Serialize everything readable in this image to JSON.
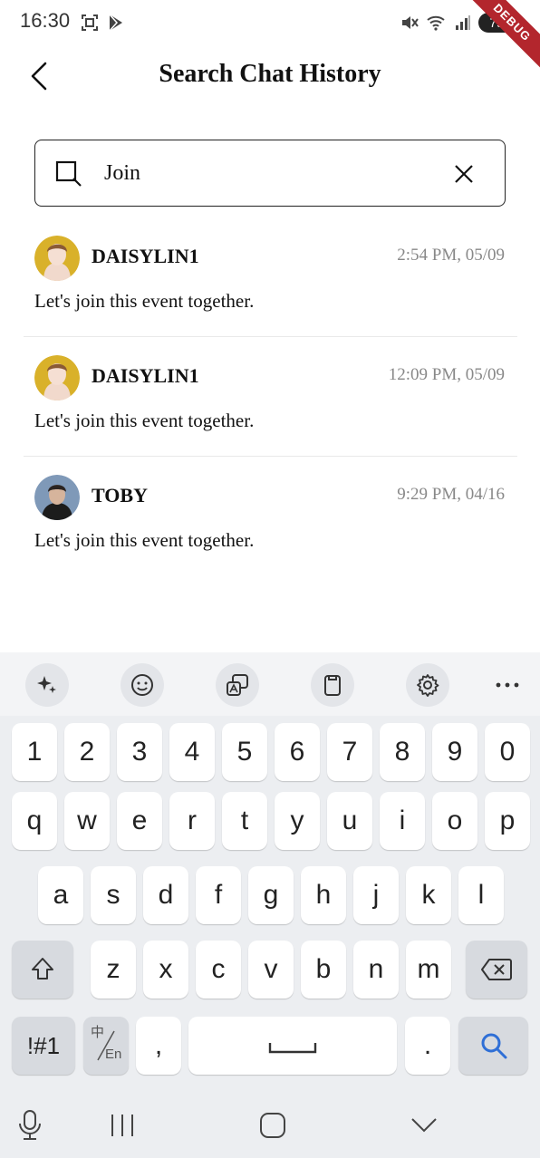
{
  "status_bar": {
    "time": "16:30",
    "battery": "79",
    "debug_label": "DEBUG"
  },
  "header": {
    "title": "Search Chat History"
  },
  "search": {
    "value": "Join"
  },
  "results": [
    {
      "name": "DAISYLIN1",
      "time": "2:54 PM, 05/09",
      "message": "Let's join this event together."
    },
    {
      "name": "DAISYLIN1",
      "time": "12:09 PM, 05/09",
      "message": "Let's join this event together."
    },
    {
      "name": "TOBY",
      "time": "9:29 PM, 04/16",
      "message": "Let's join this event together."
    }
  ],
  "keyboard": {
    "toolbar": [
      "sparkle-icon",
      "emoji-icon",
      "translate-icon",
      "clipboard-icon",
      "settings-icon",
      "more-icon"
    ],
    "row_numbers": [
      "1",
      "2",
      "3",
      "4",
      "5",
      "6",
      "7",
      "8",
      "9",
      "0"
    ],
    "row_1": [
      "q",
      "w",
      "e",
      "r",
      "t",
      "y",
      "u",
      "i",
      "o",
      "p"
    ],
    "row_2": [
      "a",
      "s",
      "d",
      "f",
      "g",
      "h",
      "j",
      "k",
      "l"
    ],
    "row_3": [
      "z",
      "x",
      "c",
      "v",
      "b",
      "n",
      "m"
    ],
    "symbols_label": "!#1",
    "lang_top": "中",
    "lang_bottom": "En",
    "comma": ",",
    "period": "."
  },
  "colors": {
    "accent": "#2f6fd6",
    "keyboard_bg": "#eceef1",
    "debug_ribbon": "#b3262d"
  }
}
